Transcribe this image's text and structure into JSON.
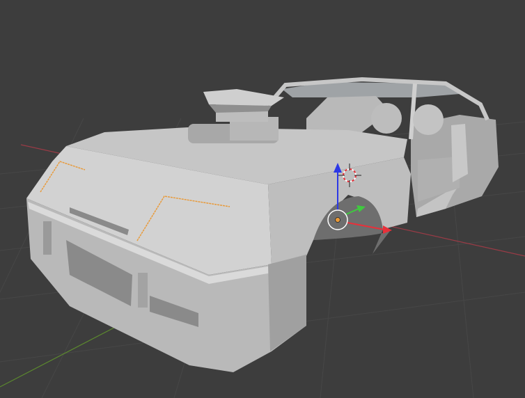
{
  "viewport": {
    "kind": "3d-viewport",
    "selected_object": "car-body",
    "colors": {
      "background": "#3d3d3d",
      "grid": "#474747",
      "x_axis": "#9a3b46",
      "y_axis": "#5c8a2e",
      "gizmo_x": "#e8303a",
      "gizmo_y": "#3fc93f",
      "gizmo_z": "#2c39e6",
      "selection_edge": "#e89a3a",
      "mesh_light": "#c9c9c9",
      "mesh_mid": "#b4b4b4",
      "mesh_dark": "#8e8e8e"
    },
    "icons": [
      "3d-cursor-icon",
      "transform-gizmo-icon",
      "origin-point-icon"
    ]
  }
}
